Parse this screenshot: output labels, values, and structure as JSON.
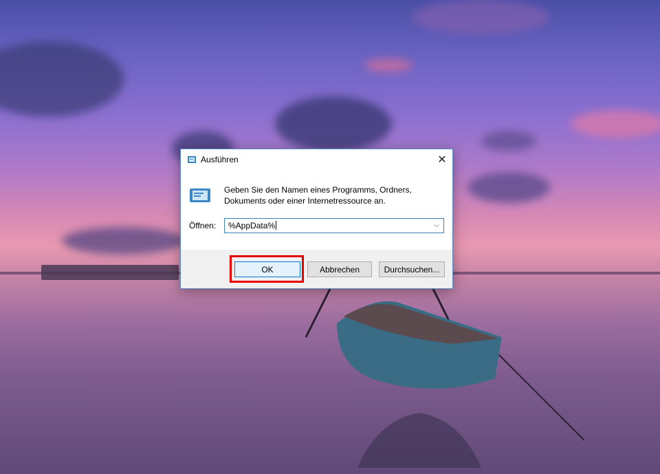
{
  "dialog": {
    "title": "Ausführen",
    "description_line1": "Geben Sie den Namen eines Programms, Ordners,",
    "description_line2": "Dokuments oder einer Internetressource an.",
    "open_label": "Öffnen:",
    "open_value": "%AppData%",
    "buttons": {
      "ok": "OK",
      "cancel": "Abbrechen",
      "browse": "Durchsuchen..."
    },
    "close_symbol": "✕",
    "dropdown_symbol": "⌵"
  },
  "colors": {
    "highlight": "#e60000",
    "accent": "#0078d7",
    "dialog_border": "#5d8cc5"
  },
  "icons": {
    "title": "run-icon",
    "content": "run-icon",
    "close": "close-icon",
    "dropdown": "chevron-down-icon"
  }
}
